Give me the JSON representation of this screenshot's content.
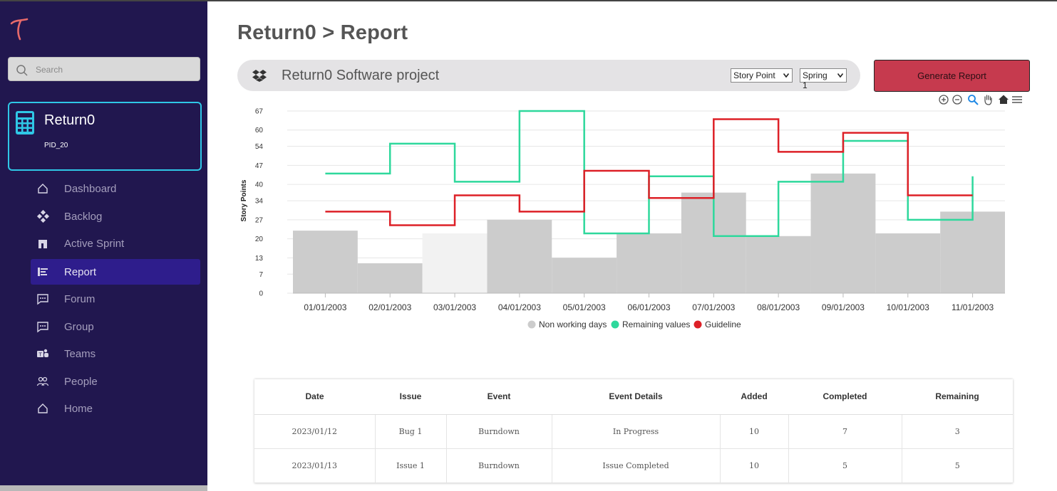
{
  "sidebar": {
    "search_placeholder": "Search",
    "project": {
      "name": "Return0",
      "id": "PID_20"
    },
    "items": [
      {
        "label": "Dashboard",
        "icon": "home-icon"
      },
      {
        "label": "Backlog",
        "icon": "diamond-icon"
      },
      {
        "label": "Active Sprint",
        "icon": "sprint-icon"
      },
      {
        "label": "Report",
        "icon": "report-icon",
        "active": true
      },
      {
        "label": "Forum",
        "icon": "chat-icon"
      },
      {
        "label": "Group",
        "icon": "chat-icon"
      },
      {
        "label": "Teams",
        "icon": "teams-icon"
      },
      {
        "label": "People",
        "icon": "people-icon"
      },
      {
        "label": "Home",
        "icon": "home-icon"
      }
    ]
  },
  "header": {
    "breadcrumb": "Return0 > Report"
  },
  "project_bar": {
    "name": "Return0 Software project",
    "metric_select": "Story Point",
    "sprint_select": "Spring 1"
  },
  "actions": {
    "generate_label": "Generate Report"
  },
  "colors": {
    "sidebar": "#21174f",
    "accent": "#c63a4e",
    "remaining": "#2ed89c",
    "guideline": "#dd2027",
    "non_working": "#cccccc"
  },
  "chart_data": {
    "type": "bar",
    "categories": [
      "01/01/2003",
      "02/01/2003",
      "03/01/2003",
      "04/01/2003",
      "05/01/2003",
      "06/01/2003",
      "07/01/2003",
      "08/01/2003",
      "09/01/2003",
      "10/01/2003",
      "11/01/2003"
    ],
    "ylabel": "Story Points",
    "yticks": [
      0,
      7,
      13,
      20,
      27,
      34,
      40,
      47,
      54,
      60,
      67
    ],
    "ylim": [
      0,
      67
    ],
    "grid": true,
    "legend_position": "bottom",
    "series": [
      {
        "name": "Non working days",
        "type": "bar",
        "color": "#cccccc",
        "values": [
          23,
          11,
          22,
          27,
          13,
          22,
          37,
          21,
          44,
          22,
          30
        ]
      },
      {
        "name": "Remaining values",
        "type": "step",
        "color": "#2ed89c",
        "values": [
          44,
          55,
          41,
          67,
          22,
          43,
          21,
          41,
          56,
          27,
          27
        ]
      },
      {
        "name": "Guideline",
        "type": "step",
        "color": "#dd2027",
        "values": [
          30,
          25,
          36,
          30,
          45,
          35,
          64,
          52,
          59,
          36,
          36
        ]
      }
    ]
  },
  "table": {
    "headers": [
      "Date",
      "Issue",
      "Event",
      "Event Details",
      "Added",
      "Completed",
      "Remaining"
    ],
    "rows": [
      [
        "2023/01/12",
        "Bug 1",
        "Burndown",
        "In Progress",
        "10",
        "7",
        "3"
      ],
      [
        "2023/01/13",
        "Issue 1",
        "Burndown",
        "Issue Completed",
        "10",
        "5",
        "5"
      ]
    ]
  }
}
